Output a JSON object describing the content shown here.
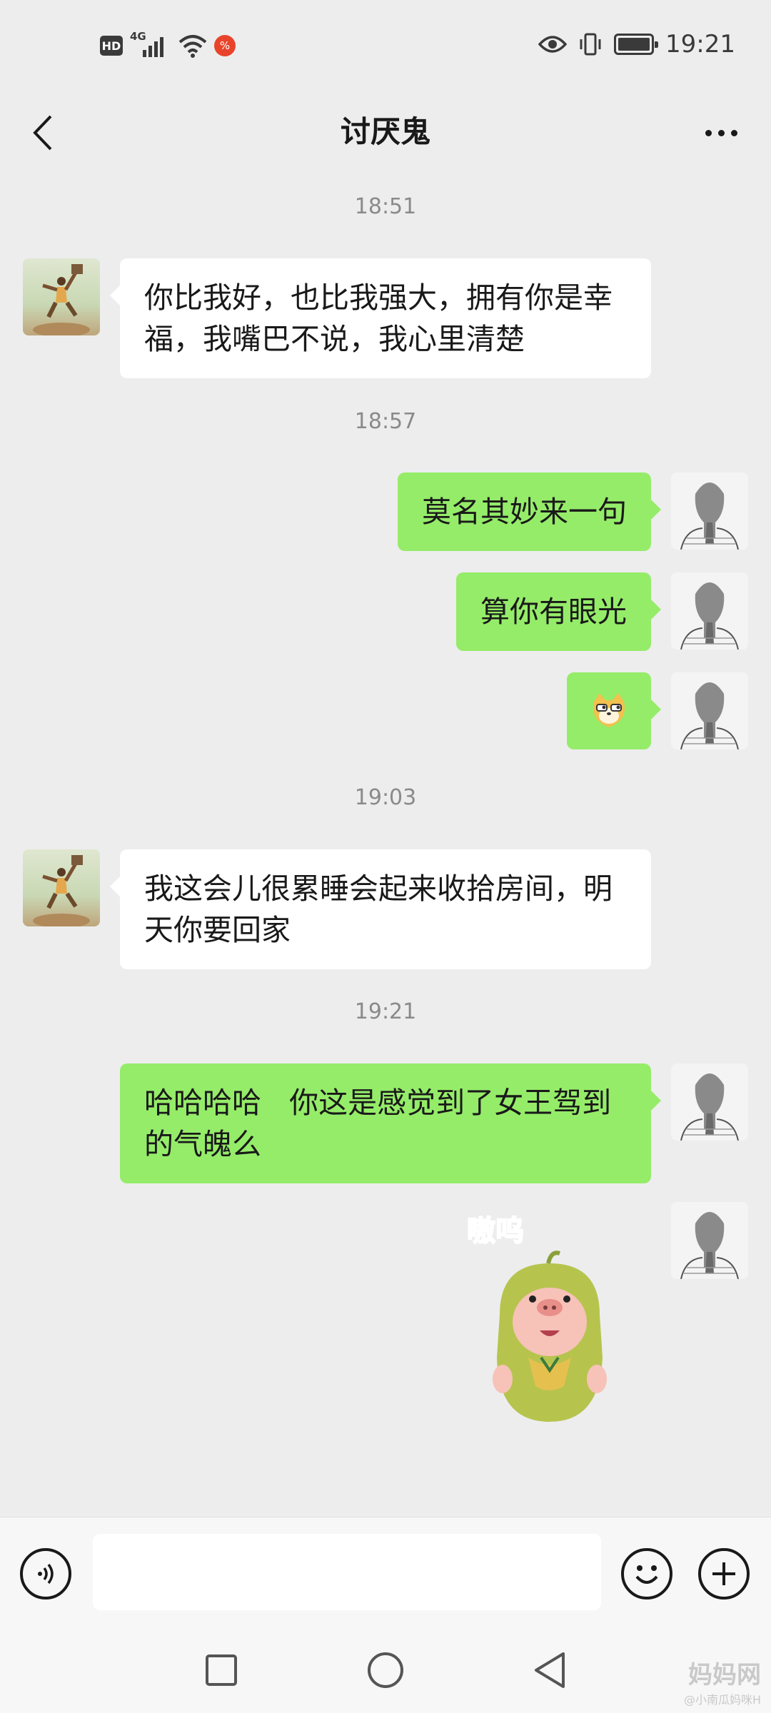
{
  "status_bar": {
    "hd": "HD",
    "network": "4G",
    "time": "19:21",
    "icons": [
      "hd-badge-icon",
      "signal-icon",
      "wifi-icon",
      "app-notification-icon",
      "eye-icon",
      "vibrate-icon",
      "battery-icon"
    ]
  },
  "nav": {
    "title": "讨厌鬼",
    "back_icon": "chevron-left-icon",
    "more_icon": "more-dots-icon"
  },
  "chat": {
    "time_labels": [
      "18:51",
      "18:57",
      "19:03",
      "19:21"
    ],
    "messages": [
      {
        "from": "friend",
        "type": "text",
        "text": "你比我好，也比我强大，拥有你是幸福，我嘴巴不说，我心里清楚"
      },
      {
        "from": "me",
        "type": "text",
        "text": "莫名其妙来一句"
      },
      {
        "from": "me",
        "type": "text",
        "text": "算你有眼光"
      },
      {
        "from": "me",
        "type": "emoji",
        "text": "",
        "emoji": "doge-emoji"
      },
      {
        "from": "friend",
        "type": "text",
        "text": "我这会儿很累睡会起来收拾房间，明天你要回家"
      },
      {
        "from": "me",
        "type": "text",
        "text": "哈哈哈哈   你这是感觉到了女王驾到的气魄么"
      },
      {
        "from": "me",
        "type": "sticker",
        "text": "嗷呜",
        "sticker": "pig-sticker"
      }
    ]
  },
  "input_bar": {
    "voice_icon": "voice-icon",
    "emoji_icon": "emoji-icon",
    "plus_icon": "plus-icon",
    "placeholder": ""
  },
  "system_nav": {
    "icons": [
      "recents-square-icon",
      "home-circle-icon",
      "back-triangle-icon"
    ]
  },
  "watermark": {
    "main": "妈妈网",
    "sub": "@小南瓜妈咪H"
  },
  "colors": {
    "background": "#ededed",
    "bubble_out": "#95ec69",
    "bubble_in": "#ffffff",
    "time_text": "#8a8a8a"
  }
}
